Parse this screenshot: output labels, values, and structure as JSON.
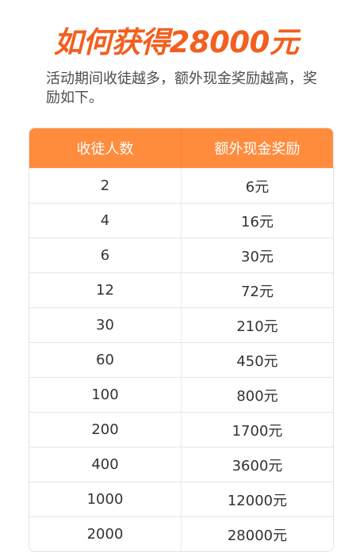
{
  "headline": "如何获得28000元",
  "intro": "活动期间收徒越多，额外现金奖励越高，奖励如下。",
  "table": {
    "headers": [
      "收徒人数",
      "额外现金奖励"
    ],
    "rows": [
      [
        "2",
        "6元"
      ],
      [
        "4",
        "16元"
      ],
      [
        "6",
        "30元"
      ],
      [
        "12",
        "72元"
      ],
      [
        "30",
        "210元"
      ],
      [
        "60",
        "450元"
      ],
      [
        "100",
        "800元"
      ],
      [
        "200",
        "1700元"
      ],
      [
        "400",
        "3600元"
      ],
      [
        "1000",
        "12000元"
      ],
      [
        "2000",
        "28000元"
      ]
    ]
  },
  "colors": {
    "headline": "#f25f1f",
    "table_header": "#ff8c3d"
  }
}
